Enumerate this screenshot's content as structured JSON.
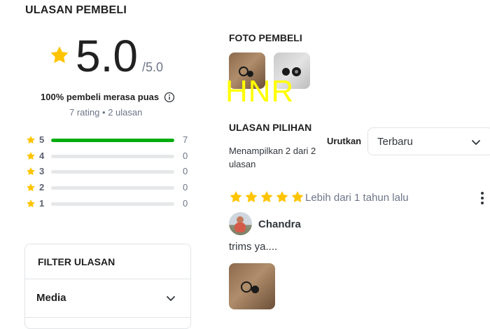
{
  "summary": {
    "title": "ULASAN PEMBELI",
    "rating": "5.0",
    "rating_max": "/5.0",
    "satisfaction": "100% pembeli merasa puas",
    "rating_count": "7 rating",
    "separator": "•",
    "review_count": "2 ulasan",
    "distribution": [
      {
        "level": "5",
        "count": "7",
        "fraction": 1.0
      },
      {
        "level": "4",
        "count": "0",
        "fraction": 0
      },
      {
        "level": "3",
        "count": "0",
        "fraction": 0
      },
      {
        "level": "2",
        "count": "0",
        "fraction": 0
      },
      {
        "level": "1",
        "count": "0",
        "fraction": 0
      }
    ]
  },
  "filter": {
    "title": "FILTER ULASAN",
    "media_label": "Media"
  },
  "photos": {
    "title": "FOTO PEMBELI",
    "watermark": "HNR"
  },
  "featured": {
    "title": "ULASAN PILIHAN",
    "showing": "Menampilkan 2 dari 2 ulasan",
    "sort_label": "Urutkan",
    "sort_value": "Terbaru"
  },
  "review": {
    "stars": 5,
    "time": "Lebih dari 1 tahun lalu",
    "reviewer": "Chandra",
    "text": "trims ya...."
  },
  "colors": {
    "star": "#FFC400",
    "accent_green": "#03AC0E",
    "watermark": "#FFFF00"
  },
  "icons": [
    "star-icon",
    "info-icon",
    "chevron-down-icon",
    "more-vertical-icon"
  ]
}
